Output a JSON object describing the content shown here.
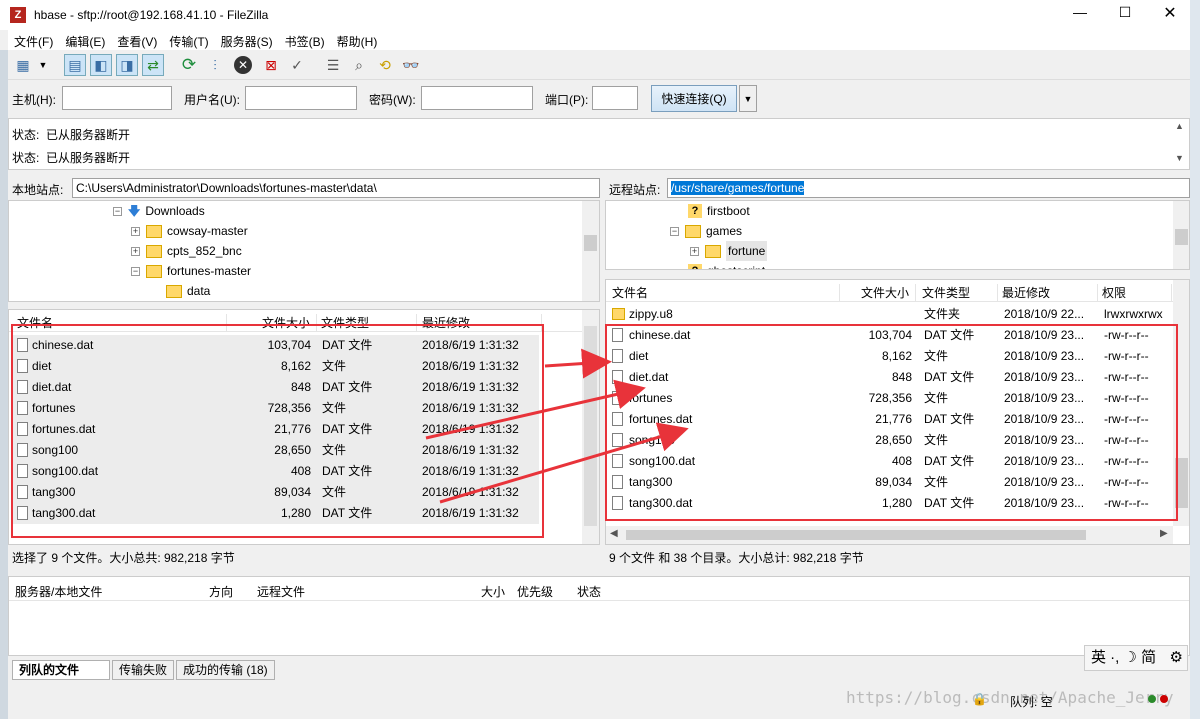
{
  "window": {
    "title": "hbase - sftp://root@192.168.41.10 - FileZilla"
  },
  "menu": [
    "文件(F)",
    "编辑(E)",
    "查看(V)",
    "传输(T)",
    "服务器(S)",
    "书签(B)",
    "帮助(H)"
  ],
  "quickconnect": {
    "host_label": "主机(H):",
    "user_label": "用户名(U):",
    "pass_label": "密码(W):",
    "port_label": "端口(P):",
    "button": "快速连接(Q)"
  },
  "log": [
    "状态:  已从服务器断开",
    "状态:  已从服务器断开"
  ],
  "local": {
    "site_label": "本地站点:",
    "path": "C:\\Users\\Administrator\\Downloads\\fortunes-master\\data\\",
    "tree": [
      "Downloads",
      "cowsay-master",
      "cpts_852_bnc",
      "fortunes-master",
      "data"
    ],
    "columns": [
      "文件名",
      "文件大小",
      "文件类型",
      "最近修改"
    ],
    "files": [
      {
        "name": "chinese.dat",
        "size": "103,704",
        "type": "DAT 文件",
        "modified": "2018/6/19 1:31:32"
      },
      {
        "name": "diet",
        "size": "8,162",
        "type": "文件",
        "modified": "2018/6/19 1:31:32"
      },
      {
        "name": "diet.dat",
        "size": "848",
        "type": "DAT 文件",
        "modified": "2018/6/19 1:31:32"
      },
      {
        "name": "fortunes",
        "size": "728,356",
        "type": "文件",
        "modified": "2018/6/19 1:31:32"
      },
      {
        "name": "fortunes.dat",
        "size": "21,776",
        "type": "DAT 文件",
        "modified": "2018/6/19 1:31:32"
      },
      {
        "name": "song100",
        "size": "28,650",
        "type": "文件",
        "modified": "2018/6/19 1:31:32"
      },
      {
        "name": "song100.dat",
        "size": "408",
        "type": "DAT 文件",
        "modified": "2018/6/19 1:31:32"
      },
      {
        "name": "tang300",
        "size": "89,034",
        "type": "文件",
        "modified": "2018/6/19 1:31:32"
      },
      {
        "name": "tang300.dat",
        "size": "1,280",
        "type": "DAT 文件",
        "modified": "2018/6/19 1:31:32"
      }
    ],
    "status": "选择了 9 个文件。大小总共: 982,218 字节"
  },
  "remote": {
    "site_label": "远程站点:",
    "path": "/usr/share/games/fortune",
    "tree": [
      "firstboot",
      "games",
      "fortune",
      "ghostscript"
    ],
    "columns": [
      "文件名",
      "文件大小",
      "文件类型",
      "最近修改",
      "权限"
    ],
    "top_row": {
      "name": "zippy.u8",
      "size": "",
      "type": "文件夹",
      "modified": "2018/10/9 22...",
      "perm": "lrwxrwxrwx"
    },
    "files": [
      {
        "name": "chinese.dat",
        "size": "103,704",
        "type": "DAT 文件",
        "modified": "2018/10/9 23...",
        "perm": "-rw-r--r--"
      },
      {
        "name": "diet",
        "size": "8,162",
        "type": "文件",
        "modified": "2018/10/9 23...",
        "perm": "-rw-r--r--"
      },
      {
        "name": "diet.dat",
        "size": "848",
        "type": "DAT 文件",
        "modified": "2018/10/9 23...",
        "perm": "-rw-r--r--"
      },
      {
        "name": "fortunes",
        "size": "728,356",
        "type": "文件",
        "modified": "2018/10/9 23...",
        "perm": "-rw-r--r--"
      },
      {
        "name": "fortunes.dat",
        "size": "21,776",
        "type": "DAT 文件",
        "modified": "2018/10/9 23...",
        "perm": "-rw-r--r--"
      },
      {
        "name": "song100",
        "size": "28,650",
        "type": "文件",
        "modified": "2018/10/9 23...",
        "perm": "-rw-r--r--"
      },
      {
        "name": "song100.dat",
        "size": "408",
        "type": "DAT 文件",
        "modified": "2018/10/9 23...",
        "perm": "-rw-r--r--"
      },
      {
        "name": "tang300",
        "size": "89,034",
        "type": "文件",
        "modified": "2018/10/9 23...",
        "perm": "-rw-r--r--"
      },
      {
        "name": "tang300.dat",
        "size": "1,280",
        "type": "DAT 文件",
        "modified": "2018/10/9 23...",
        "perm": "-rw-r--r--"
      }
    ],
    "status": "9 个文件 和 38 个目录。大小总计: 982,218 字节"
  },
  "queue": {
    "columns": [
      "服务器/本地文件",
      "方向",
      "远程文件",
      "大小",
      "优先级",
      "状态"
    ]
  },
  "tabs": [
    "列队的文件",
    "传输失败",
    "成功的传输 (18)"
  ],
  "footer": {
    "queue_status": "队列: 空",
    "ime": "英 ·, ☽ 简",
    "watermark": "https://blog.csdn.net/Apache_Jerry"
  },
  "colors": {
    "annotation": "#e8333a",
    "selection": "#0078d7"
  }
}
